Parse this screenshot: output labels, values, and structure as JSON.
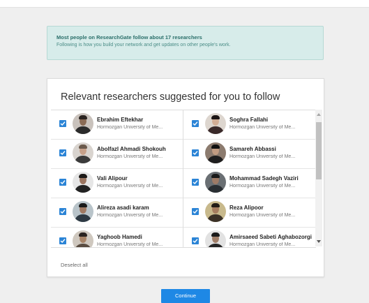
{
  "banner": {
    "title": "Most people on ResearchGate follow about 17 researchers",
    "subtitle": "Following is how you build your network and get updates on other people's work."
  },
  "card": {
    "title": "Relevant researchers suggested for you to follow",
    "deselect_label": "Deselect all"
  },
  "researchers_left": [
    {
      "name": "Ebrahim Eftekhar",
      "institution": "Hormozgan University of Me...",
      "checked": true
    },
    {
      "name": "Abolfazl Ahmadi Shokouh",
      "institution": "Hormozgan University of Me...",
      "checked": true
    },
    {
      "name": "Vali Alipour",
      "institution": "Hormozgan University of Me...",
      "checked": true
    },
    {
      "name": "Alireza asadi karam",
      "institution": "Hormozgan University of Me...",
      "checked": true
    },
    {
      "name": "Yaghoob Hamedi",
      "institution": "Hormozgan University of Me...",
      "checked": true
    }
  ],
  "researchers_right": [
    {
      "name": "Soghra Fallahi",
      "institution": "Hormozgan University of Me...",
      "checked": true
    },
    {
      "name": "Samareh Abbassi",
      "institution": "Hormozgan University of Me...",
      "checked": true
    },
    {
      "name": "Mohammad Sadegh Vaziri",
      "institution": "Hormozgan University of Me...",
      "checked": true
    },
    {
      "name": "Reza Alipoor",
      "institution": "Hormozgan University of Me...",
      "checked": true
    },
    {
      "name": "Amirsaeed Sabeti Aghabozorgi",
      "institution": "Hormozgan University of Me...",
      "checked": true
    }
  ],
  "continue_label": "Continue",
  "colors": {
    "accent": "#1e88e5",
    "checkbox": "#2b84d6",
    "banner_bg": "#d7ecea",
    "banner_text": "#2a6f6a"
  }
}
